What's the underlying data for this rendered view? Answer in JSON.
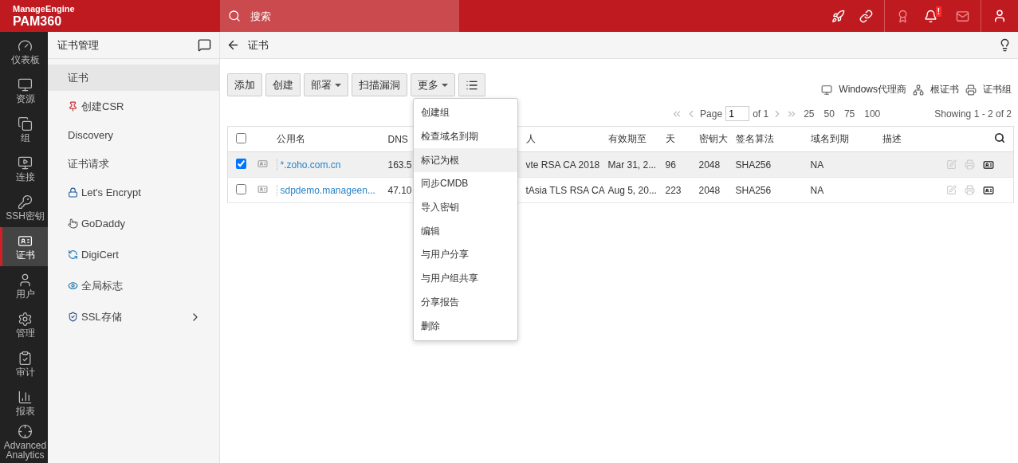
{
  "topbar": {
    "company": "ManageEngine",
    "product": "PAM360",
    "search": {
      "placeholder": "搜索"
    },
    "alert_badge": "!"
  },
  "nav": {
    "items": [
      {
        "label": "仪表板",
        "selected": false
      },
      {
        "label": "资源",
        "selected": false
      },
      {
        "label": "组",
        "selected": false
      },
      {
        "label": "连接",
        "selected": false
      },
      {
        "label": "SSH密钥",
        "selected": false
      },
      {
        "label": "证书",
        "selected": true
      },
      {
        "label": "用户",
        "selected": false
      },
      {
        "label": "管理",
        "selected": false
      },
      {
        "label": "审计",
        "selected": false
      },
      {
        "label": "报表",
        "selected": false
      },
      {
        "label": "Advanced Analytics",
        "selected": false
      }
    ]
  },
  "submenu": {
    "title": "证书管理",
    "items": [
      {
        "label": "证书",
        "selected": true,
        "expandable": false
      },
      {
        "label": "创建CSR",
        "selected": false,
        "expandable": false
      },
      {
        "label": "Discovery",
        "selected": false,
        "expandable": false
      },
      {
        "label": "证书请求",
        "selected": false,
        "expandable": false
      },
      {
        "label": "Let's Encrypt",
        "selected": false,
        "expandable": false
      },
      {
        "label": "GoDaddy",
        "selected": false,
        "expandable": false
      },
      {
        "label": "DigiCert",
        "selected": false,
        "expandable": false
      },
      {
        "label": "全局标志",
        "selected": false,
        "expandable": false
      },
      {
        "label": "SSL存储",
        "selected": false,
        "expandable": true
      }
    ]
  },
  "page": {
    "title": "证书"
  },
  "toolbar": {
    "buttons": [
      {
        "kind": "text",
        "label": "添加",
        "dropdown": false
      },
      {
        "kind": "text",
        "label": "创建",
        "dropdown": false
      },
      {
        "kind": "text",
        "label": "部署",
        "dropdown": true
      },
      {
        "kind": "text",
        "label": "扫描漏洞",
        "dropdown": false
      },
      {
        "kind": "text",
        "label": "更多",
        "dropdown": true,
        "open": true
      },
      {
        "kind": "icon"
      }
    ],
    "links": [
      "Windows代理商",
      "根证书",
      "证书组"
    ]
  },
  "menu": {
    "items": [
      {
        "label": "创建组",
        "highlighted": false
      },
      {
        "label": "检查域名到期",
        "highlighted": false
      },
      {
        "label": "标记为根",
        "highlighted": true
      },
      {
        "label": "同步CMDB",
        "highlighted": false
      },
      {
        "label": "导入密钥",
        "highlighted": false
      },
      {
        "label": "编辑",
        "highlighted": false
      },
      {
        "label": "与用户分享",
        "highlighted": false
      },
      {
        "label": "与用户组共享",
        "highlighted": false
      },
      {
        "label": "分享报告",
        "highlighted": false
      },
      {
        "label": "删除",
        "highlighted": false
      }
    ]
  },
  "pagination": {
    "page_label": "Page",
    "page_value": "1",
    "of": "of 1",
    "sizes": [
      "25",
      "50",
      "75",
      "100"
    ],
    "showing": "Showing 1 - 2 of 2"
  },
  "table": {
    "all_checked": false,
    "columns": [
      "公用名",
      "DNS",
      "人",
      "有效期至",
      "天",
      "密钥大",
      "签名算法",
      "域名到期",
      "描述"
    ],
    "rows": [
      {
        "checked": true,
        "cells": [
          "*.zoho.com.cn",
          "163.5",
          "vte RSA CA 2018",
          "Mar 31, 2...",
          "96",
          "2048",
          "SHA256",
          "NA"
        ]
      },
      {
        "checked": false,
        "cells": [
          "sdpdemo.manageen...",
          "47.10",
          "tAsia TLS RSA CA",
          "Aug 5, 20...",
          "223",
          "2048",
          "SHA256",
          "NA"
        ]
      }
    ]
  }
}
